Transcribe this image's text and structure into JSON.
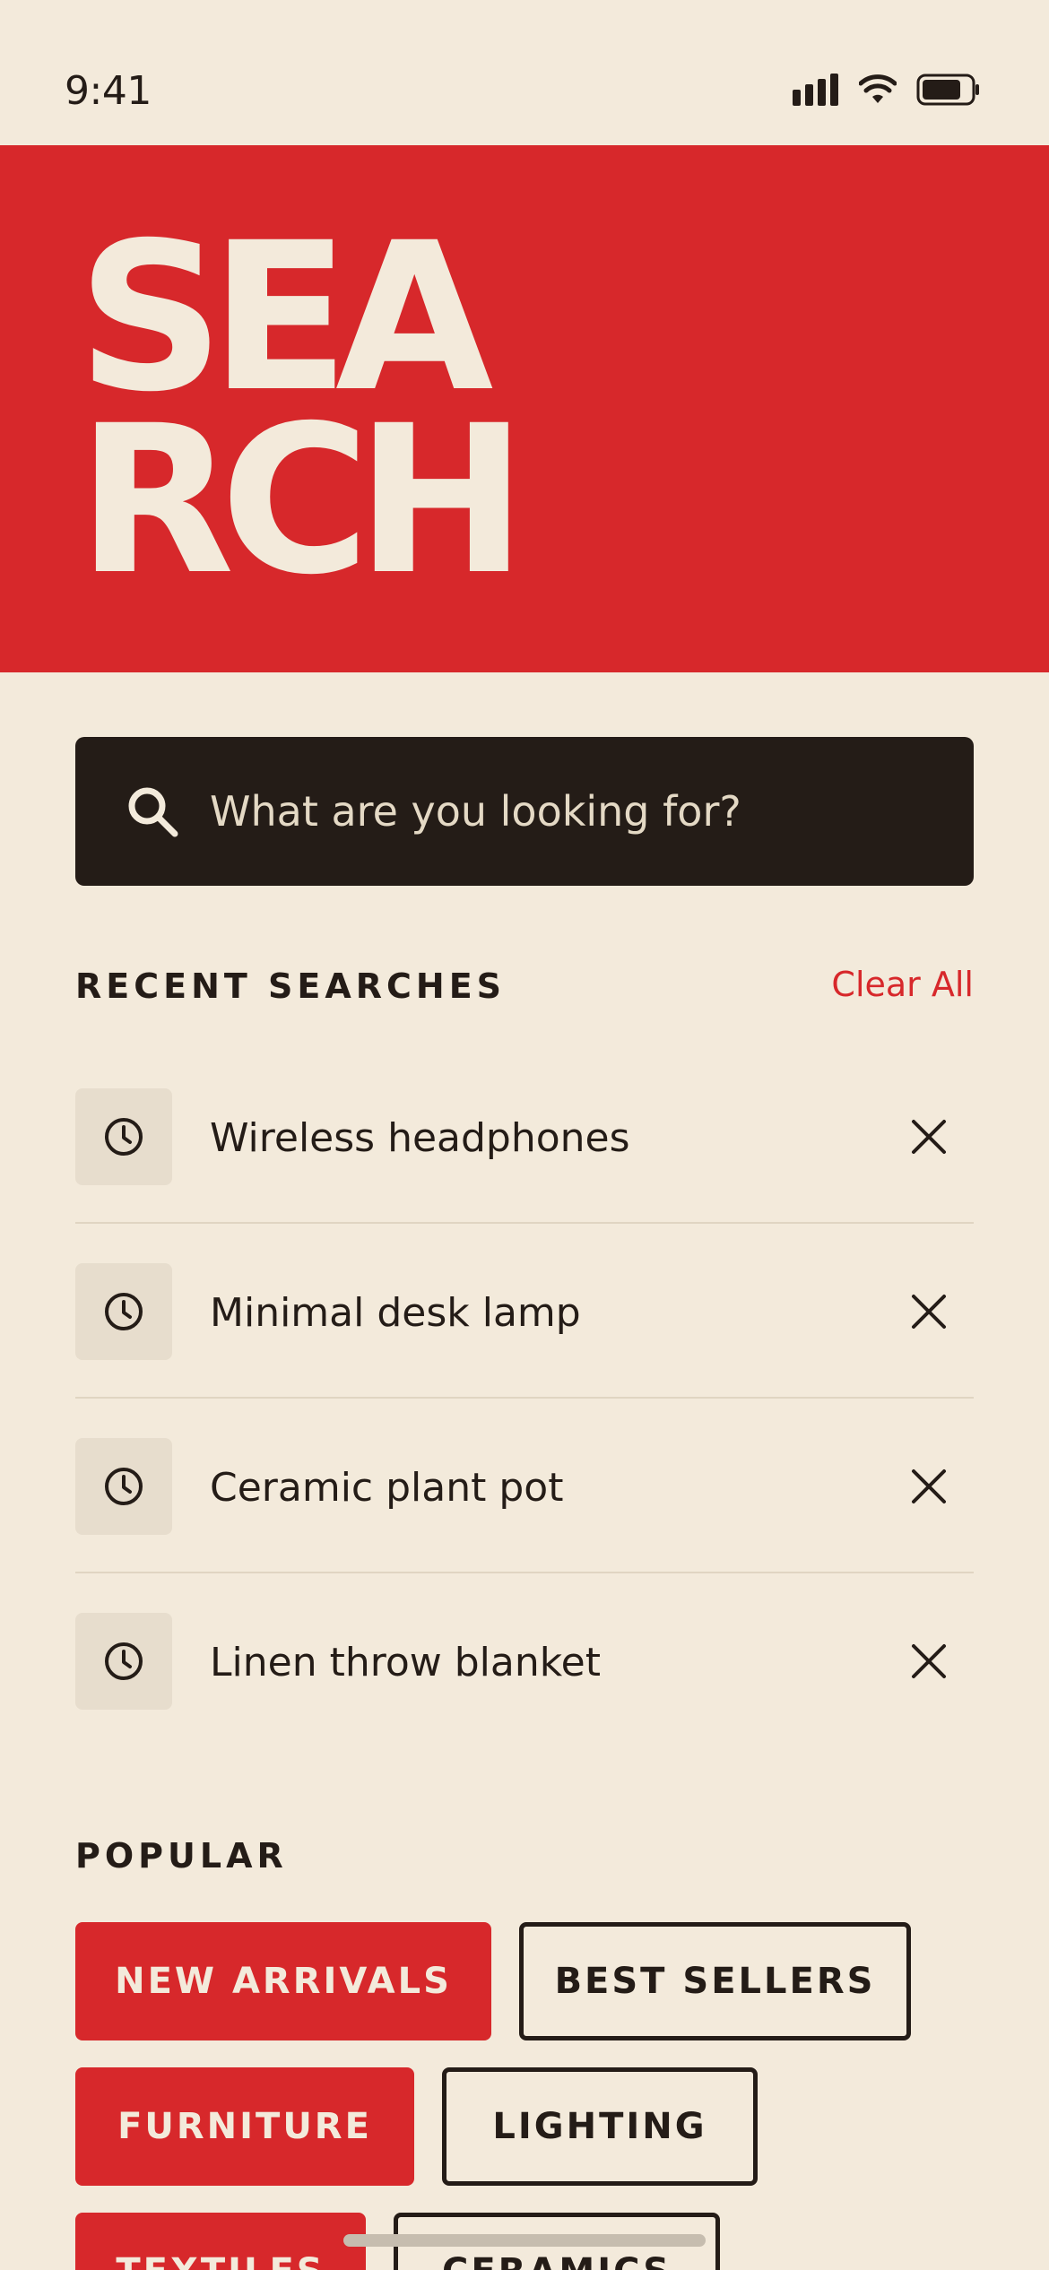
{
  "status_bar": {
    "time": "9:41",
    "icons": [
      "signal-icon",
      "wifi-icon",
      "battery-icon"
    ]
  },
  "hero": {
    "title": "SEARCH"
  },
  "search": {
    "placeholder": "What are you looking for?",
    "value": ""
  },
  "recent": {
    "title": "RECENT SEARCHES",
    "clear_label": "Clear All",
    "items": [
      {
        "label": "Wireless headphones"
      },
      {
        "label": "Minimal desk lamp"
      },
      {
        "label": "Ceramic plant pot"
      },
      {
        "label": "Linen throw blanket"
      }
    ]
  },
  "popular": {
    "title": "POPULAR",
    "chips": [
      {
        "label": "NEW ARRIVALS",
        "style": "filled"
      },
      {
        "label": "BEST SELLERS",
        "style": "outline"
      },
      {
        "label": "FURNITURE",
        "style": "filled"
      },
      {
        "label": "LIGHTING",
        "style": "outline"
      },
      {
        "label": "TEXTILES",
        "style": "filled"
      },
      {
        "label": "CERAMICS",
        "style": "outline"
      }
    ]
  },
  "colors": {
    "accent": "#D7282B",
    "background": "#F3EADB",
    "ink": "#241C17",
    "tile": "#E7DDCD"
  }
}
